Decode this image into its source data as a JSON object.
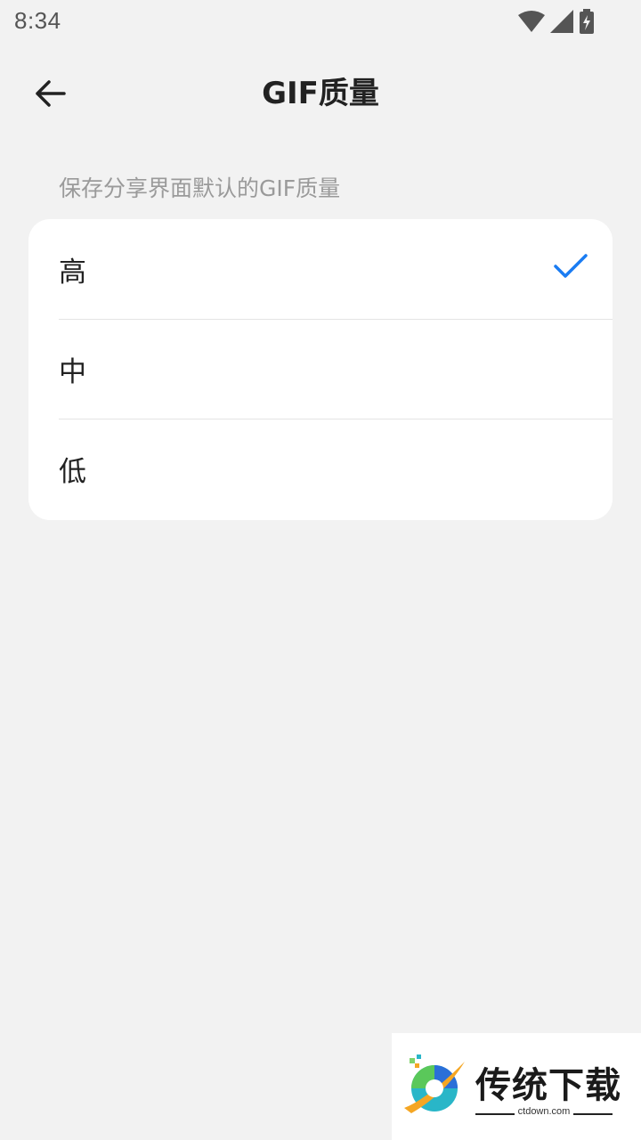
{
  "status_bar": {
    "time": "8:34",
    "icons": [
      "wifi-icon",
      "signal-icon",
      "battery-charging-icon"
    ]
  },
  "app_bar": {
    "back_icon": "arrow-left-icon",
    "title": "GIF质量"
  },
  "section": {
    "description": "保存分享界面默认的GIF质量"
  },
  "options": [
    {
      "label": "高",
      "selected": true
    },
    {
      "label": "中",
      "selected": false
    },
    {
      "label": "低",
      "selected": false
    }
  ],
  "colors": {
    "background": "#f2f2f2",
    "card": "#ffffff",
    "accent": "#1a7cf2",
    "description": "#9a9a9a"
  },
  "watermark": {
    "title": "传统下载",
    "domain": "ctdown.com"
  }
}
